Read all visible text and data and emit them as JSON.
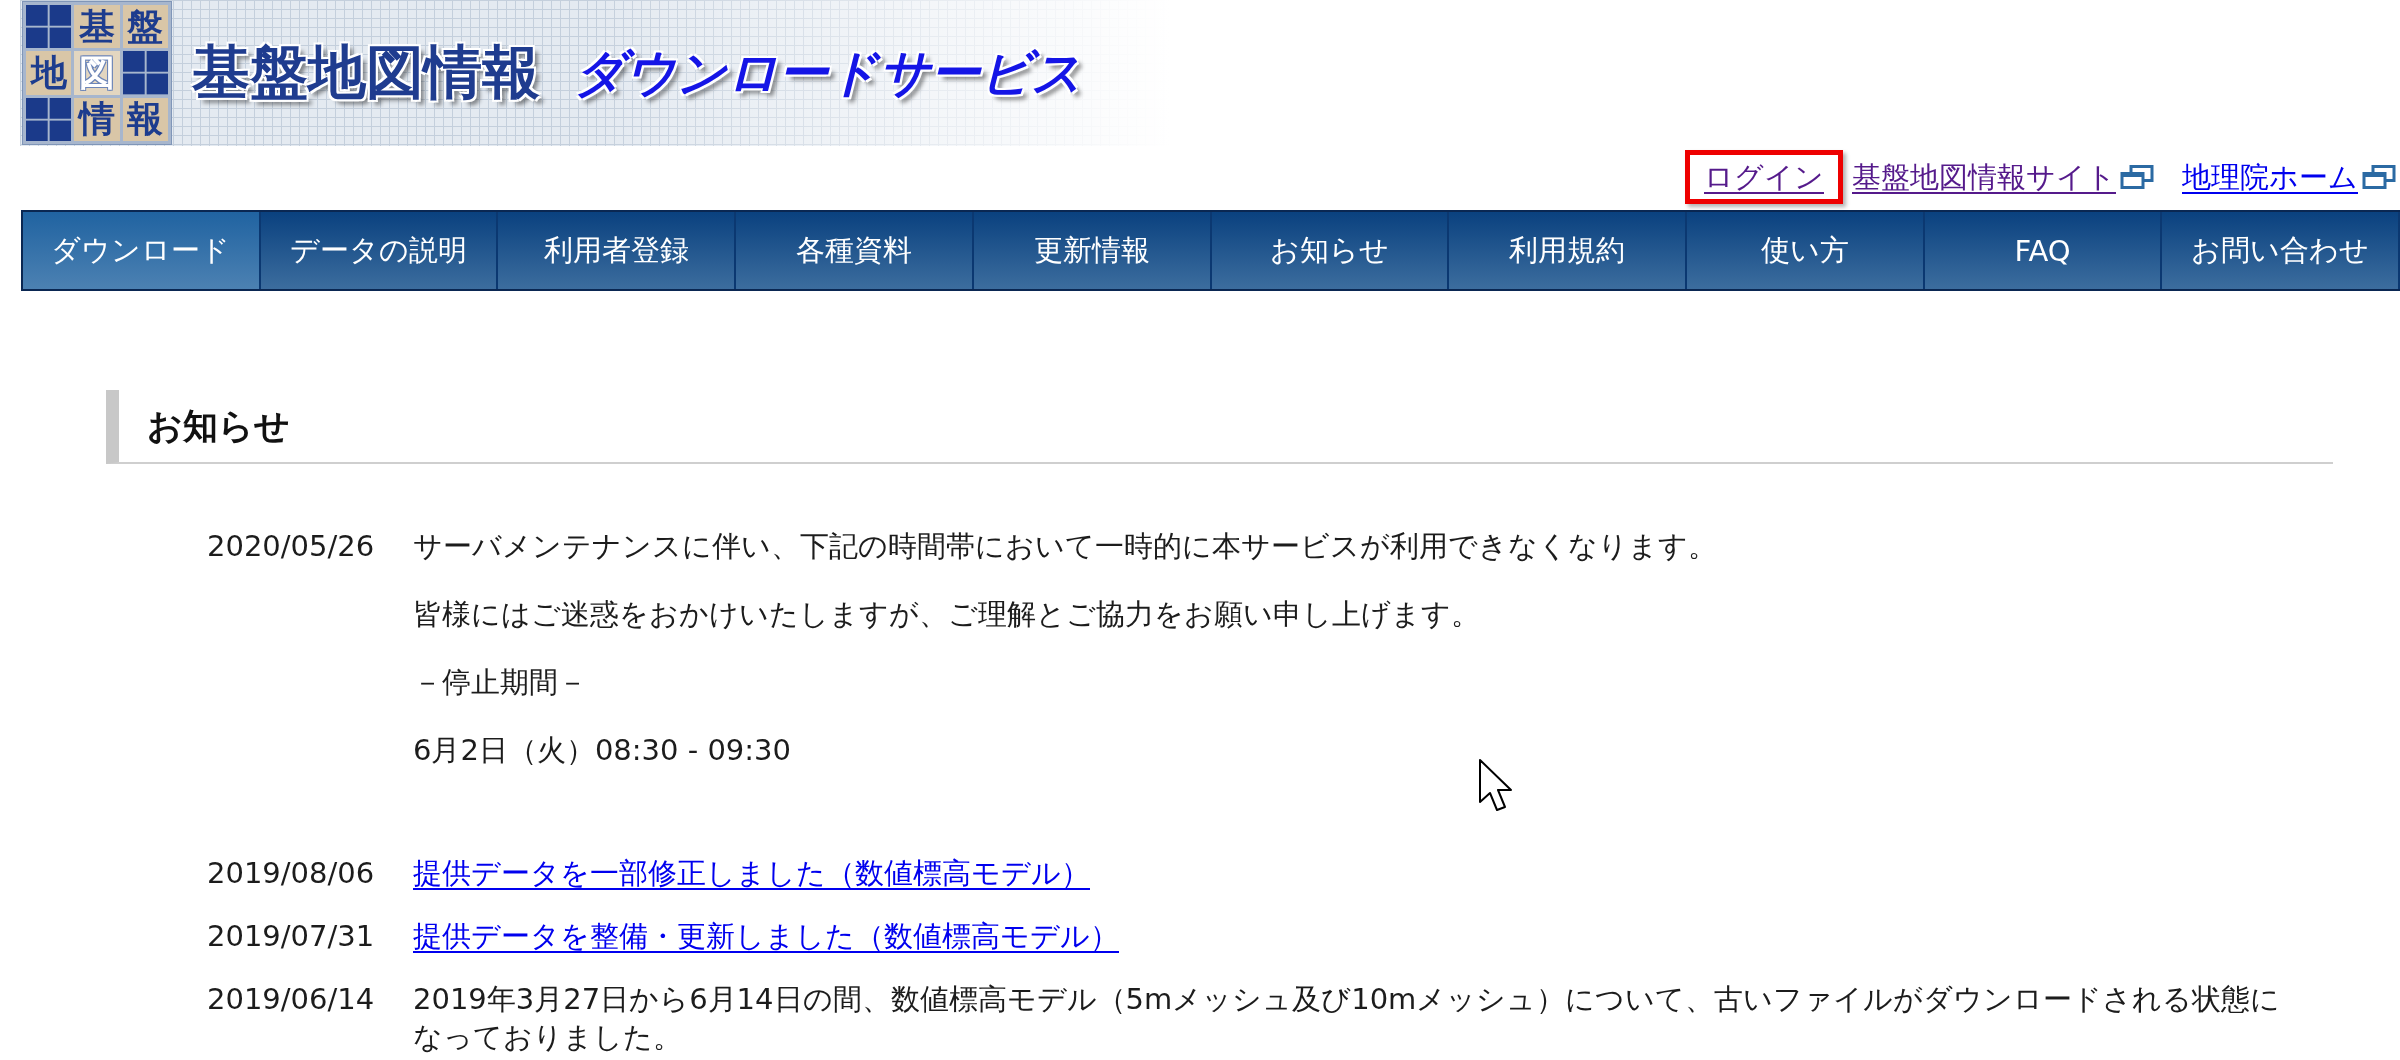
{
  "header": {
    "logo": {
      "cells": [
        {
          "kind": "block"
        },
        {
          "kind": "char",
          "text": "基"
        },
        {
          "kind": "char",
          "text": "盤"
        },
        {
          "kind": "char",
          "text": "地"
        },
        {
          "kind": "char_outlined",
          "text": "図"
        },
        {
          "kind": "block"
        },
        {
          "kind": "block"
        },
        {
          "kind": "char",
          "text": "情"
        },
        {
          "kind": "char",
          "text": "報"
        }
      ]
    },
    "title": "基盤地図情報",
    "subtitle": "ダウンロードサービス"
  },
  "top_links": [
    {
      "label": "ログイン",
      "visited": true,
      "external": false,
      "highlighted": true
    },
    {
      "label": "基盤地図情報サイト",
      "visited": true,
      "external": true,
      "highlighted": false
    },
    {
      "label": "地理院ホーム",
      "visited": false,
      "external": true,
      "highlighted": false
    }
  ],
  "nav": [
    {
      "label": "ダウンロード",
      "selected": true
    },
    {
      "label": "データの説明",
      "selected": false
    },
    {
      "label": "利用者登録",
      "selected": false
    },
    {
      "label": "各種資料",
      "selected": false
    },
    {
      "label": "更新情報",
      "selected": false
    },
    {
      "label": "お知らせ",
      "selected": false
    },
    {
      "label": "利用規約",
      "selected": false
    },
    {
      "label": "使い方",
      "selected": false
    },
    {
      "label": "FAQ",
      "selected": false
    },
    {
      "label": "お問い合わせ",
      "selected": false
    }
  ],
  "section": {
    "title": "お知らせ",
    "entries": [
      {
        "date": "2020/05/26",
        "kind": "text",
        "paragraphs": [
          "サーバメンテナンスに伴い、下記の時間帯において一時的に本サービスが利用できなくなります。",
          "皆様にはご迷惑をおかけいたしますが、ご理解とご協力をお願い申し上げます。",
          "－停止期間－",
          "6月2日（火）08:30 - 09:30"
        ]
      },
      {
        "date": "2019/08/06",
        "kind": "link",
        "paragraphs": [
          "提供データを一部修正しました（数値標高モデル）"
        ]
      },
      {
        "date": "2019/07/31",
        "kind": "link",
        "paragraphs": [
          "提供データを整備・更新しました（数値標高モデル）"
        ]
      },
      {
        "date": "2019/06/14",
        "kind": "text",
        "paragraphs": [
          "2019年3月27日から6月14日の間、数値標高モデル（5mメッシュ及び10mメッシュ）について、古いファイルがダウンロードされる状態になっておりました。"
        ]
      }
    ]
  }
}
